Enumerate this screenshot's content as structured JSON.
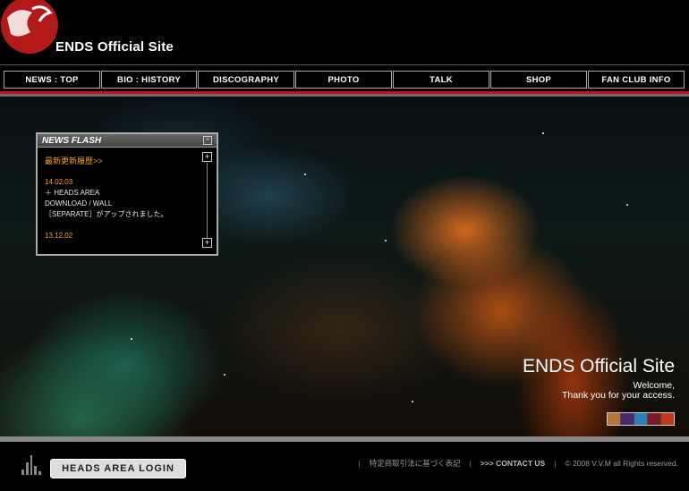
{
  "header": {
    "site_title": "ENDS Official Site"
  },
  "nav": {
    "items": [
      {
        "label": "NEWS : TOP"
      },
      {
        "label": "BIO : HISTORY"
      },
      {
        "label": "DISCOGRAPHY"
      },
      {
        "label": "PHOTO"
      },
      {
        "label": "TALK"
      },
      {
        "label": "SHOP"
      },
      {
        "label": "FAN CLUB INFO"
      }
    ]
  },
  "news_flash": {
    "title": "NEWS FLASH",
    "link": "最新更新履歴>>",
    "entries": [
      {
        "date": "14.02.03",
        "line1": "＋ HEADS AREA",
        "line2": "DOWNLOAD / WALL",
        "line3": "［SEPARATE］がアップされました。"
      },
      {
        "date": "13.12.02"
      }
    ]
  },
  "hero": {
    "title": "ENDS Official Site",
    "welcome": "Welcome,",
    "thanks": "Thank you for your access."
  },
  "footer": {
    "login_label": "HEADS AREA LOGIN",
    "law_link": "特定商取引法に基づく表記",
    "contact_label": ">>> CONTACT US",
    "copyright": "© 2008 V.V.M all Rights reserved."
  },
  "colors": {
    "accent": "#c81111",
    "news": "#f7a21b"
  }
}
